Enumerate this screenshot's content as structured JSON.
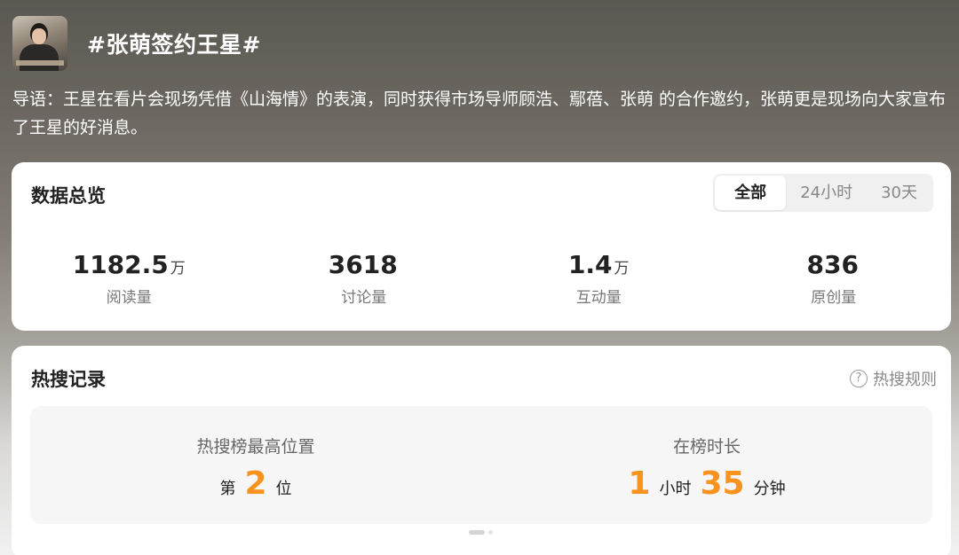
{
  "header": {
    "title": "#张萌签约王星#"
  },
  "intro": "导语：王星在看片会现场凭借《山海情》的表演，同时获得市场导师顾浩、鄢蓓、张萌 的合作邀约，张萌更是现场向大家宣布了王星的好消息。",
  "overview": {
    "title": "数据总览",
    "tabs": [
      "全部",
      "24小时",
      "30天"
    ],
    "selected_tab": "全部",
    "stats": [
      {
        "value": "1182.5",
        "unit": "万",
        "label": "阅读量"
      },
      {
        "value": "3618",
        "unit": "",
        "label": "讨论量"
      },
      {
        "value": "1.4",
        "unit": "万",
        "label": "互动量"
      },
      {
        "value": "836",
        "unit": "",
        "label": "原创量"
      }
    ]
  },
  "hot": {
    "title": "热搜记录",
    "rules_label": "热搜规则",
    "peak": {
      "label": "热搜榜最高位置",
      "prefix": "第",
      "value": "2",
      "suffix": "位"
    },
    "duration": {
      "label": "在榜时长",
      "hours": "1",
      "hours_unit": "小时",
      "minutes": "35",
      "minutes_unit": "分钟"
    }
  },
  "colors": {
    "accent": "#f7931e",
    "card": "#ffffff"
  },
  "icons": {
    "rules": "question-circle-icon"
  }
}
